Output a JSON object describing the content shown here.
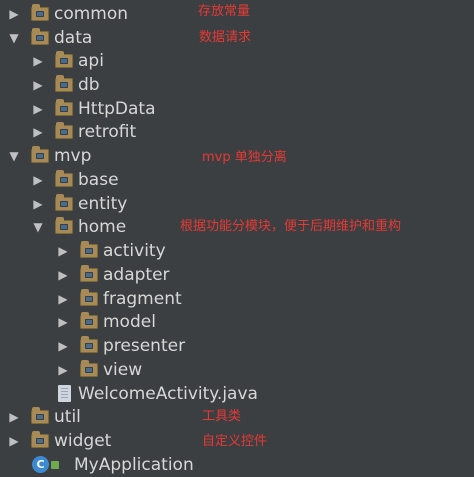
{
  "tree": {
    "common": "common",
    "data": "data",
    "api": "api",
    "db": "db",
    "httpdata": "HttpData",
    "retrofit": "retrofit",
    "mvp": "mvp",
    "base": "base",
    "entity": "entity",
    "home": "home",
    "activity": "activity",
    "adapter": "adapter",
    "fragment": "fragment",
    "model": "model",
    "presenter": "presenter",
    "view": "view",
    "welcome": "WelcomeActivity.java",
    "util": "util",
    "widget": "widget",
    "myapplication": "MyApplication"
  },
  "icons": {
    "collapsed": "▶",
    "expanded": "▼",
    "class_letter": "C"
  },
  "annotations": {
    "common": "存放常量",
    "data": "数据请求",
    "mvp": "mvp 单独分离",
    "home": "根据功能分模块，便于后期维护和重构",
    "util": "工具类",
    "widget": "自定义控件"
  },
  "colors": {
    "background": "#3c3f41",
    "text": "#d7d7d7",
    "annotation": "#e53935",
    "folder": "#a78a55",
    "class_icon": "#3d8ad1"
  }
}
